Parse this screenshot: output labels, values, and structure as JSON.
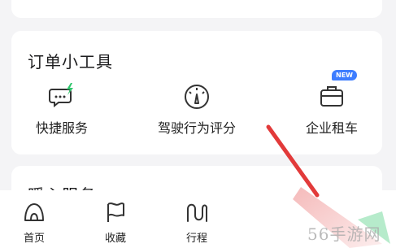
{
  "tools_section": {
    "title": "订单小工具",
    "items": [
      {
        "label": "快捷服务",
        "icon": "quick-service-chat-icon"
      },
      {
        "label": "驾驶行为评分",
        "icon": "speedometer-icon"
      },
      {
        "label": "企业租车",
        "icon": "briefcase-icon",
        "badge": "NEW"
      }
    ]
  },
  "service_section": {
    "title": "暖心服务"
  },
  "tabbar": {
    "items": [
      {
        "label": "首页",
        "icon": "home-icon"
      },
      {
        "label": "收藏",
        "icon": "flag-icon"
      },
      {
        "label": "行程",
        "icon": "route-icon"
      }
    ]
  },
  "watermark": "56手游网",
  "colors": {
    "accent": "#3d7dff",
    "green": "#2ec56b",
    "arrow": "#e23a3a"
  }
}
